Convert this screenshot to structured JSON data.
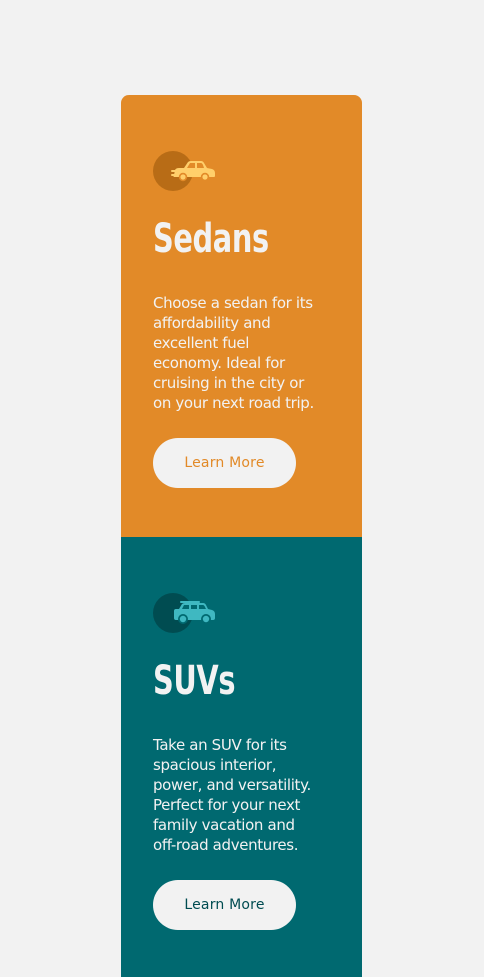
{
  "colors": {
    "page_background": "#f2f2f2",
    "sedan_card": "#e28a28",
    "suv_card": "#006970",
    "text_light": "#f2f2f2"
  },
  "cards": [
    {
      "icon": "sedan-car-icon",
      "title": "Sedans",
      "description": "Choose a sedan for its affordability and excellent fuel economy. Ideal for cruising in the city or on your next road trip.",
      "button_label": "Learn More"
    },
    {
      "icon": "suv-car-icon",
      "title": "SUVs",
      "description": "Take an SUV for its spacious interior, power, and versatility. Perfect for your next family vacation and off-road adventures.",
      "button_label": "Learn More"
    }
  ]
}
